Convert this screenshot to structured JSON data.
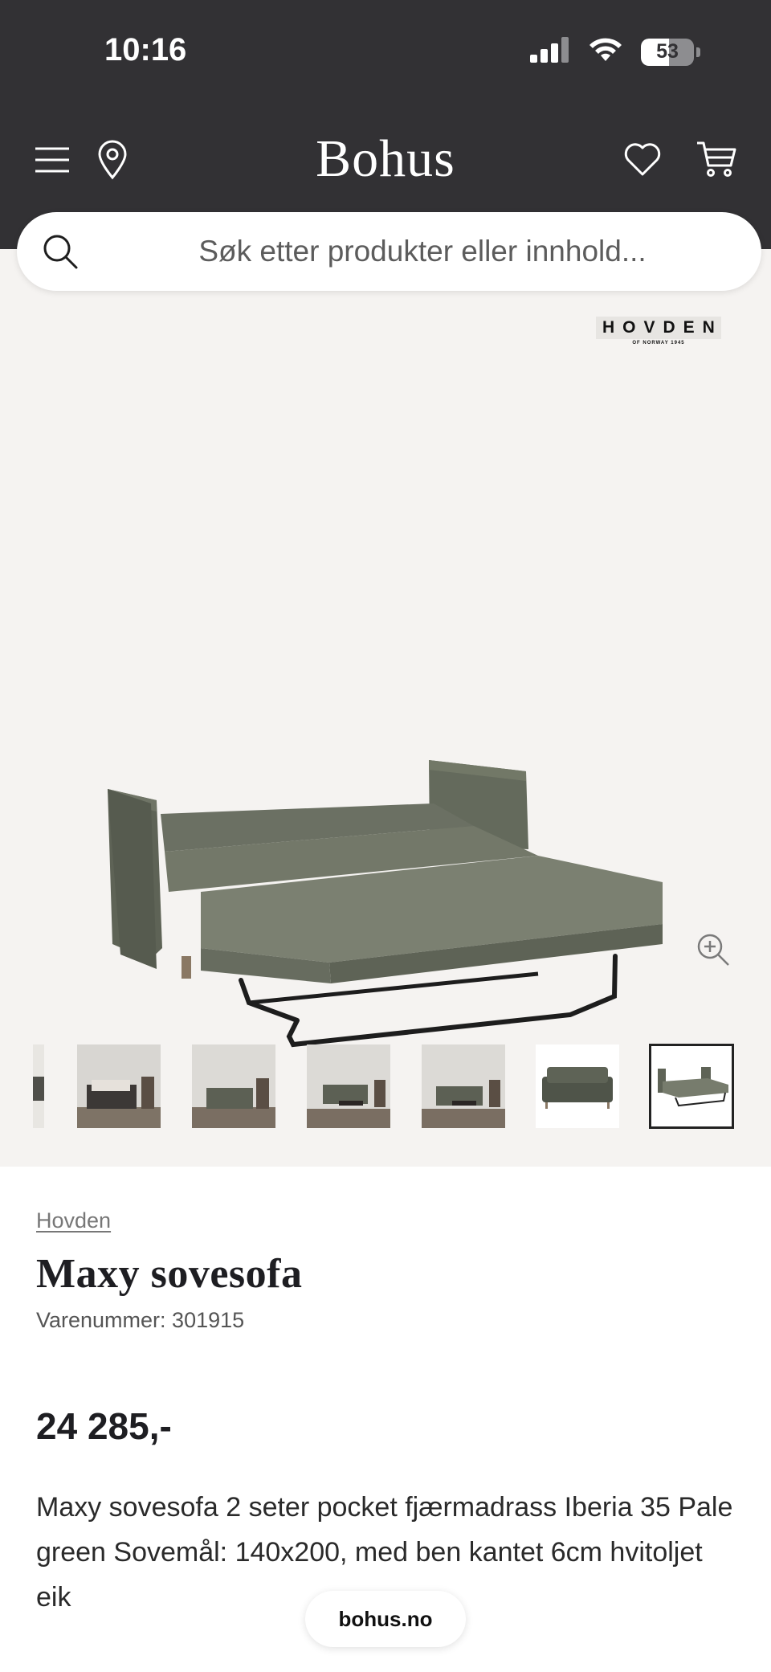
{
  "status_bar": {
    "time": "10:16",
    "battery_percent": 53,
    "battery_label": "53",
    "signal_icon": "signal-bars-icon",
    "wifi_icon": "wifi-icon"
  },
  "header": {
    "logo": "Bohus",
    "left_icons": [
      "menu-icon",
      "location-pin-icon"
    ],
    "right_icons": [
      "heart-icon",
      "cart-icon"
    ],
    "background_color": "#323134"
  },
  "search": {
    "placeholder": "Søk etter produkter eller innhold..."
  },
  "gallery": {
    "brand_logo_text": "HOVDEN",
    "brand_logo_subtext": "OF NORWAY 1945",
    "zoom_icon": "zoom-in-icon",
    "thumbnail_count_visible": 7,
    "active_thumbnail_index": 6,
    "thumbnail_descriptions": [
      "partial",
      "sofa-bed-room",
      "sofa-room",
      "sofa-room-table",
      "sofa-room-table",
      "sofa-white",
      "sofa-bed-open"
    ]
  },
  "product": {
    "brand": "Hovden",
    "title": "Maxy sovesofa",
    "sku_label": "Varenummer: 301915",
    "price": "24 285,-",
    "description": "Maxy sovesofa 2 seter pocket fjærmadrass Iberia 35 Pale green Sovemål: 140x200, med ben kantet 6cm hvitoljet eik"
  },
  "browser": {
    "url": "bohus.no"
  }
}
